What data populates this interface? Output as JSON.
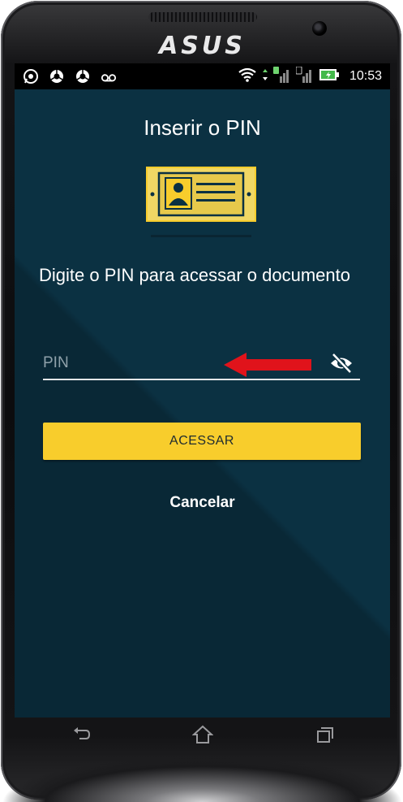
{
  "device": {
    "brand": "ASUS"
  },
  "statusbar": {
    "left_icons": [
      "whatsapp-icon",
      "chrome-icon",
      "chrome-icon",
      "voicemail-icon"
    ],
    "time": "10:53"
  },
  "screen": {
    "title": "Inserir o PIN",
    "prompt": "Digite o PIN para acessar o documento",
    "pin_placeholder": "PIN",
    "access_label": "ACESSAR",
    "cancel_label": "Cancelar"
  },
  "colors": {
    "background": "#0b3142",
    "accent": "#f8cd2c",
    "arrow": "#e0131b"
  }
}
